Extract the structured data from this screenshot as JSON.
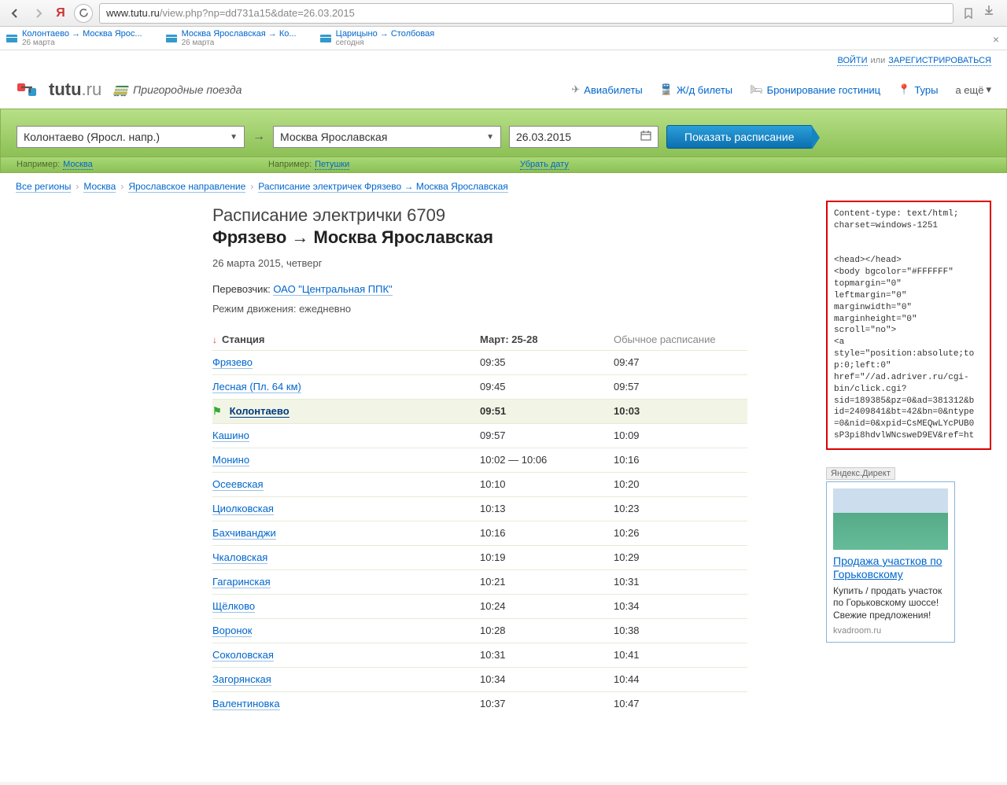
{
  "browser": {
    "url_prefix": "www.tutu.ru",
    "url_rest": "/view.php?np=dd731a15&date=26.03.2015"
  },
  "favorites": [
    {
      "title": "Колонтаево → Москва Ярос...",
      "sub": "26 марта"
    },
    {
      "title": "Москва Ярославская → Ко...",
      "sub": "26 марта"
    },
    {
      "title": "Царицыно → Столбовая",
      "sub": "сегодня"
    }
  ],
  "auth": {
    "login": "ВОЙТИ",
    "or": "или",
    "register": "ЗАРЕГИСТРИРОВАТЬСЯ"
  },
  "logo_text": "tutu",
  "logo_suffix": ".ru",
  "tagline": "Пригородные поезда",
  "nav": [
    {
      "icon": "✈",
      "label": "Авиабилеты"
    },
    {
      "icon": "🚆",
      "label": "Ж/д билеты"
    },
    {
      "icon": "🛏",
      "label": "Бронирование гостиниц"
    },
    {
      "icon": "📍",
      "label": "Туры"
    }
  ],
  "more": "а ещё",
  "search": {
    "from": "Колонтаево (Яросл. напр.)",
    "to": "Москва Ярославская",
    "date": "26.03.2015",
    "button": "Показать расписание",
    "hint_label": "Например:",
    "hint_from": "Москва",
    "hint_to": "Петушки",
    "hint_date": "Убрать дату"
  },
  "crumbs": [
    "Все регионы",
    "Москва",
    "Ярославское направление",
    "Расписание электричек Фрязево → Москва Ярославская"
  ],
  "title1": "Расписание электрички 6709",
  "title2": "Фрязево → Москва Ярославская",
  "date_line": "26 марта 2015, четверг",
  "carrier_label": "Перевозчик: ",
  "carrier_link": "ОАО \"Центральная ППК\"",
  "mode": "Режим движения: ежедневно",
  "th_station": "Станция",
  "th_period": "Март: 25-28",
  "th_usual": "Обычное расписание",
  "rows": [
    {
      "st": "Фрязево",
      "t1": "09:35",
      "t2": "09:47"
    },
    {
      "st": "Лесная (Пл. 64 км)",
      "t1": "09:45",
      "t2": "09:57"
    },
    {
      "st": "Колонтаево",
      "t1": "09:51",
      "t2": "10:03",
      "hl": true
    },
    {
      "st": "Кашино",
      "t1": "09:57",
      "t2": "10:09"
    },
    {
      "st": "Монино",
      "t1": "10:02 — 10:06",
      "t2": "10:16"
    },
    {
      "st": "Осеевская",
      "t1": "10:10",
      "t2": "10:20"
    },
    {
      "st": "Циолковская",
      "t1": "10:13",
      "t2": "10:23"
    },
    {
      "st": "Бахчиванджи",
      "t1": "10:16",
      "t2": "10:26"
    },
    {
      "st": "Чкаловская",
      "t1": "10:19",
      "t2": "10:29"
    },
    {
      "st": "Гагаринская",
      "t1": "10:21",
      "t2": "10:31"
    },
    {
      "st": "Щёлково",
      "t1": "10:24",
      "t2": "10:34"
    },
    {
      "st": "Воронок",
      "t1": "10:28",
      "t2": "10:38"
    },
    {
      "st": "Соколовская",
      "t1": "10:31",
      "t2": "10:41"
    },
    {
      "st": "Загорянская",
      "t1": "10:34",
      "t2": "10:44"
    },
    {
      "st": "Валентиновка",
      "t1": "10:37",
      "t2": "10:47"
    }
  ],
  "code": "Content-type: text/html;\ncharset=windows-1251\n\n\n<head></head>\n<body bgcolor=\"#FFFFFF\"\ntopmargin=\"0\"\nleftmargin=\"0\"\nmarginwidth=\"0\"\nmarginheight=\"0\"\nscroll=\"no\">\n<a\nstyle=\"position:absolute;to\np:0;left:0\"\nhref=\"//ad.adriver.ru/cgi-\nbin/click.cgi?\nsid=189385&pz=0&ad=381312&b\nid=2409841&bt=42&bn=0&ntype\n=0&nid=0&xpid=CsMEQwLYcPUB0\nsP3pi8hdvlWNcsweD9EV&ref=ht",
  "ad_label": "Яндекс.Директ",
  "ad": {
    "title": "Продажа участков по Горьковскому",
    "desc": "Купить / продать участок по Горьковскому шоссе! Свежие предложения!",
    "domain": "kvadroom.ru"
  }
}
